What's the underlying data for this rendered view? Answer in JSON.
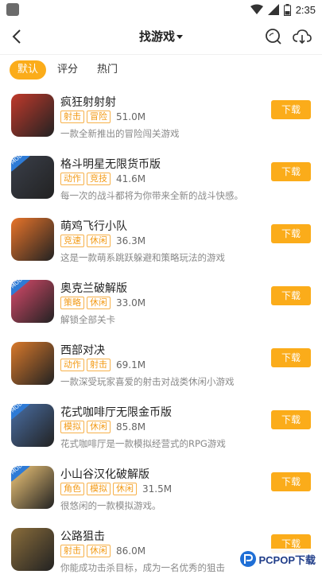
{
  "status": {
    "time": "2:35"
  },
  "header": {
    "title": "找游戏"
  },
  "tabs": [
    {
      "label": "默认",
      "active": true
    },
    {
      "label": "评分",
      "active": false
    },
    {
      "label": "热门",
      "active": false
    }
  ],
  "download_label": "下载",
  "games": [
    {
      "name": "疯狂射射射",
      "tags": [
        "射击",
        "冒险"
      ],
      "size": "51.0M",
      "desc": "一款全新推出的冒险闯关游戏",
      "mod": false,
      "icon": "anime-heroes-icon",
      "color": "#c0392b"
    },
    {
      "name": "格斗明星无限货币版",
      "tags": [
        "动作",
        "竞技"
      ],
      "size": "41.6M",
      "desc": "每一次的战斗都将为你带来全新的战斗快感。",
      "mod": true,
      "mod_label": "MOD",
      "icon": "fighter-icon",
      "color": "#3a3f4a"
    },
    {
      "name": "萌鸡飞行小队",
      "tags": [
        "竞速",
        "休闲"
      ],
      "size": "36.3M",
      "desc": "这是一款萌系跳跃躲避和策略玩法的游戏",
      "mod": false,
      "icon": "flying-chick-icon",
      "color": "#e8742a"
    },
    {
      "name": "奥克兰破解版",
      "tags": [
        "策略",
        "休闲"
      ],
      "size": "33.0M",
      "desc": "解锁全部关卡",
      "mod": true,
      "mod_label": "MOD",
      "icon": "block-face-icon",
      "color": "#d94a6b"
    },
    {
      "name": "西部对决",
      "tags": [
        "动作",
        "射击"
      ],
      "size": "69.1M",
      "desc": "一款深受玩家喜爱的射击对战类休闲小游戏",
      "mod": false,
      "icon": "cowboy-icon",
      "color": "#d9792b"
    },
    {
      "name": "花式咖啡厅无限金币版",
      "tags": [
        "模拟",
        "休闲"
      ],
      "size": "85.8M",
      "desc": "花式咖啡厅是一款模拟经营式的RPG游戏",
      "mod": true,
      "mod_label": "MOD",
      "icon": "cafe-girl-icon",
      "color": "#4a6fa5"
    },
    {
      "name": "小山谷汉化破解版",
      "tags": [
        "角色",
        "模拟",
        "休闲"
      ],
      "size": "31.5M",
      "desc": "很悠闲的一款模拟游戏。",
      "mod": true,
      "mod_label": "MOD",
      "icon": "valley-girl-icon",
      "color": "#f2c879"
    },
    {
      "name": "公路狙击",
      "tags": [
        "射击",
        "休闲"
      ],
      "size": "86.0M",
      "desc": "你能成功击杀目标，成为一名优秀的狙击",
      "mod": false,
      "icon": "sniper-icon",
      "color": "#8a6d3b"
    }
  ],
  "watermark": {
    "text": "PCPOP下载"
  }
}
